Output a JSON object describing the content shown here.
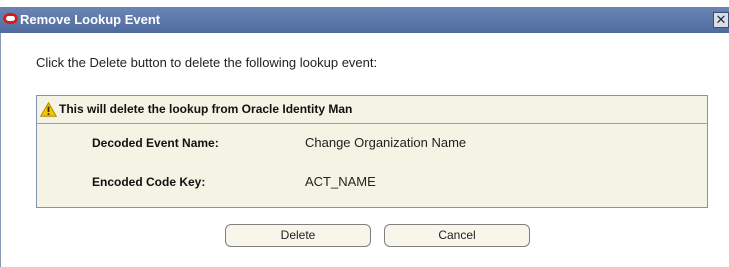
{
  "window": {
    "title": "Remove Lookup Event",
    "close_symbol": "✕",
    "logo_icon": "oracle-logo-icon",
    "titlebar_color": "#5a75a8",
    "brand_color": "#cc1f1f"
  },
  "content": {
    "instruction": "Click the Delete button to delete the following lookup event:"
  },
  "panel": {
    "warning_text": "This will delete the lookup from Oracle Identity Man",
    "warning_icon": "warning-triangle-icon",
    "background": "#f5f3e4",
    "rows": [
      {
        "label": "Decoded Event Name:",
        "value": "Change Organization Name"
      },
      {
        "label": "Encoded Code Key:",
        "value": "ACT_NAME"
      }
    ]
  },
  "buttons": {
    "delete_label": "Delete",
    "cancel_label": "Cancel"
  }
}
